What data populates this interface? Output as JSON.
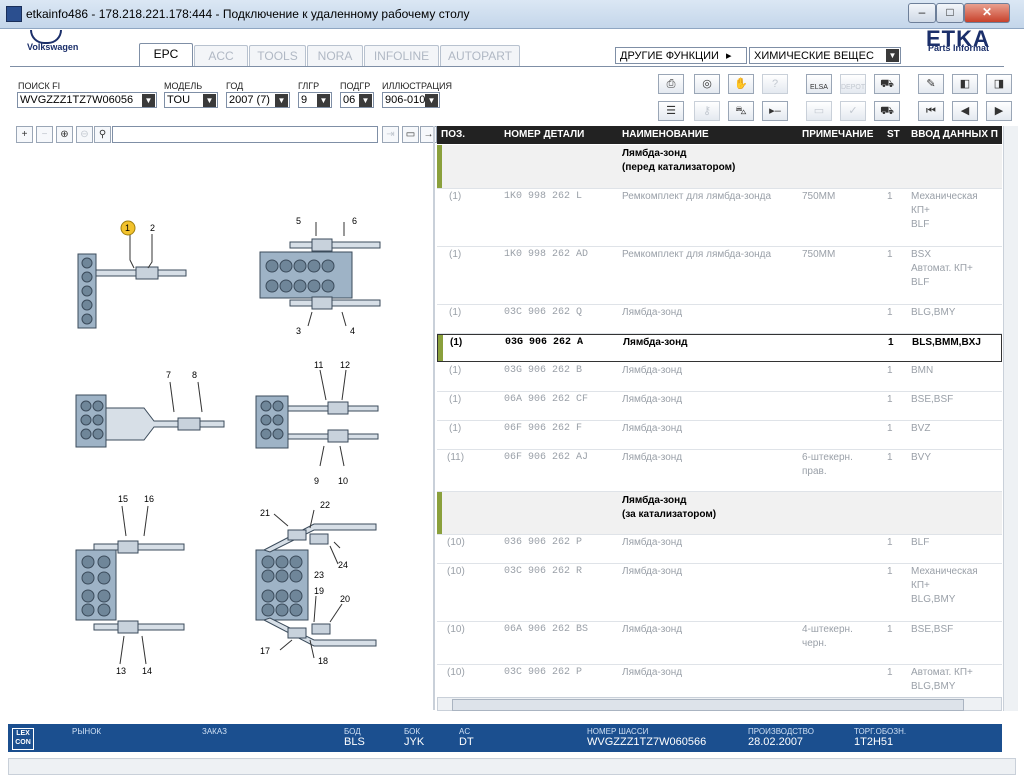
{
  "window": {
    "title": "etkainfo486 - 178.218.221.178:444 - Подключение к удаленному рабочему столу",
    "min_label": "–",
    "max_label": "□",
    "close_label": "✕"
  },
  "brand": {
    "vw_text": "Volkswagen",
    "etka_text": "ETKA",
    "etka_sub": "Parts Informat"
  },
  "tabs": [
    "EPC",
    "ACC",
    "TOOLS",
    "NORA",
    "INFOLINE",
    "AUTOPART"
  ],
  "functions": {
    "other_label": "ДРУГИЕ ФУНКЦИИ",
    "arrow": "▸",
    "selected": "ХИМИЧЕСКИЕ ВЕЩЕС"
  },
  "filters": {
    "search": {
      "label": "ПОИСК FI",
      "value": "WVGZZZ1TZ7W06056"
    },
    "model": {
      "label": "МОДЕЛЬ",
      "value": "TOU"
    },
    "year": {
      "label": "ГОД",
      "value": "2007 (7)"
    },
    "group": {
      "label": "ГЛГР",
      "value": "9"
    },
    "subgroup": {
      "label": "ПОДГР",
      "value": "06"
    },
    "illustration": {
      "label": "ИЛЛЮСТРАЦИЯ",
      "value": "906-010"
    }
  },
  "toolbar_labels": {
    "elsa": "ELSA",
    "depot": "DEPOT"
  },
  "table": {
    "headers": {
      "pos": "ПОЗ.",
      "part_no": "НОМЕР ДЕТАЛИ",
      "name": "НАИМЕНОВАНИЕ",
      "note": "ПРИМЕЧАНИЕ",
      "st": "ST",
      "data": "ВВОД ДАННЫХ П"
    },
    "sections": {
      "front_line1": "Лямбда-зонд",
      "front_line2": "(перед катализатором)",
      "rear_line1": "Лямбда-зонд",
      "rear_line2": "(за катализатором)"
    },
    "rows": [
      {
        "pos": "(1)",
        "part": "1K0 998 262 L",
        "name": "Ремкомплект для лямбда-зонда",
        "note": "750MM",
        "st": "1",
        "data1": "Механическая",
        "data2": "КП+",
        "data3": "BLF"
      },
      {
        "pos": "(1)",
        "part": "1K0 998 262 AD",
        "name": "Ремкомплект для лямбда-зонда",
        "note": "750MM",
        "st": "1",
        "data1": "BSX",
        "data2": "Автомат. КП+",
        "data3": "BLF"
      },
      {
        "pos": "(1)",
        "part": "03C 906 262 Q",
        "name": "Лямбда-зонд",
        "note": "",
        "st": "1",
        "data1": "BLG,BMY"
      },
      {
        "pos": "(1)",
        "part": "03G 906 262 A",
        "name": "Лямбда-зонд",
        "note": "",
        "st": "1",
        "data1": "BLS,BMM,BXJ"
      },
      {
        "pos": "(1)",
        "part": "03G 906 262 B",
        "name": "Лямбда-зонд",
        "note": "",
        "st": "1",
        "data1": "BMN"
      },
      {
        "pos": "(1)",
        "part": "06A 906 262 CF",
        "name": "Лямбда-зонд",
        "note": "",
        "st": "1",
        "data1": "BSE,BSF"
      },
      {
        "pos": "(1)",
        "part": "06F 906 262 F",
        "name": "Лямбда-зонд",
        "note": "",
        "st": "1",
        "data1": "BVZ"
      },
      {
        "pos": "(11)",
        "part": "06F 906 262 AJ",
        "name": "Лямбда-зонд",
        "note1": "6-штекерн.",
        "note2": "прав.",
        "st": "1",
        "data1": "BVY"
      },
      {
        "pos": "(10)",
        "part": "036 906 262 P",
        "name": "Лямбда-зонд",
        "note": "",
        "st": "1",
        "data1": "BLF"
      },
      {
        "pos": "(10)",
        "part": "03C 906 262 R",
        "name": "Лямбда-зонд",
        "note": "",
        "st": "1",
        "data1": "Механическая",
        "data2": "КП+",
        "data3": "BLG,BMY"
      },
      {
        "pos": "(10)",
        "part": "06A 906 262 BS",
        "name": "Лямбда-зонд",
        "note1": "4-штекерн.",
        "note2": "черн.",
        "st": "1",
        "data1": "BSE,BSF"
      },
      {
        "pos": "(10)",
        "part": "03C 906 262 P",
        "name": "Лямбда-зонд",
        "note": "",
        "st": "1",
        "data1": "Автомат. КП+",
        "data2": "BLG,BMY"
      }
    ]
  },
  "callouts": [
    "1",
    "2",
    "3",
    "4",
    "5",
    "6",
    "7",
    "8",
    "9",
    "10",
    "11",
    "12",
    "13",
    "14",
    "15",
    "16",
    "17",
    "18",
    "19",
    "20",
    "21",
    "22",
    "23",
    "24"
  ],
  "status": {
    "lexcon": "LEX CON",
    "market_label": "РЫНОК",
    "order_label": "ЗАКАЗ",
    "bod_label": "БОД",
    "bod_value": "BLS",
    "bok_label": "БОК",
    "bok_value": "JYK",
    "ac_label": "AC",
    "ac_value": "DT",
    "chassis_label": "НОМЕР ШАССИ",
    "chassis_value": "WVGZZZ1TZ7W060566",
    "prod_label": "ПРОИЗВОДСТВО",
    "prod_value": "28.02.2007",
    "trade_label": "ТОРГ.ОБОЗН.",
    "trade_value": "1T2H51"
  }
}
